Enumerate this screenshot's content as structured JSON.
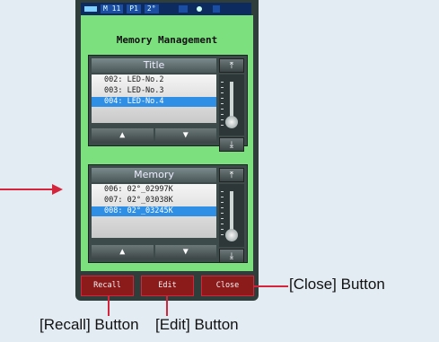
{
  "status_bar": {
    "items": [
      "M 11",
      "P1",
      "2°"
    ]
  },
  "screen_title": "Memory Management",
  "title_panel": {
    "header": "Title",
    "rows": [
      "002: LED-No.2",
      "003: LED-No.3",
      "004: LED-No.4"
    ],
    "selected_index": 2
  },
  "memory_panel": {
    "header": "Memory",
    "rows": [
      "006: 02°_02997K",
      "007: 02°_03038K",
      "008: 02°_03245K"
    ],
    "selected_index": 2
  },
  "buttons": {
    "recall": "Recall",
    "edit": "Edit",
    "close": "Close"
  },
  "callouts": {
    "close": "[Close] Button",
    "recall": "[Recall] Button",
    "edit": "[Edit] Button"
  },
  "icons": {
    "up": "▲",
    "down": "▼",
    "top": "top-arrow-icon",
    "bottom": "bottom-arrow-icon"
  },
  "colors": {
    "screen": "#7be07d",
    "selection": "#2f8fe4",
    "callout": "#d3263d"
  }
}
